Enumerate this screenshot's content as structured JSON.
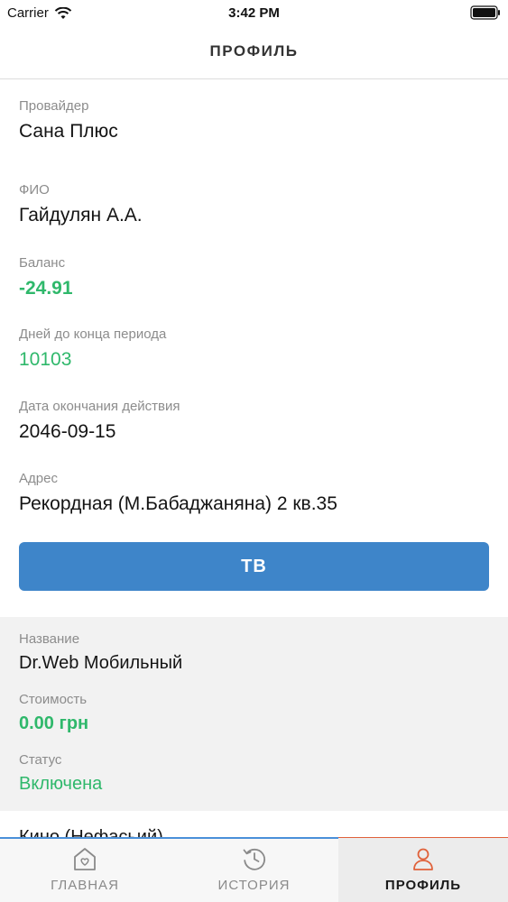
{
  "status_bar": {
    "carrier": "Carrier",
    "time": "3:42 PM",
    "icons": [
      "wifi-icon",
      "battery-icon"
    ]
  },
  "nav": {
    "title": "ПРОФИЛЬ"
  },
  "profile": {
    "provider_label": "Провайдер",
    "provider_value": "Сана Плюс",
    "name_label": "ФИО",
    "name_value": "Гайдулян А.А.",
    "balance_label": "Баланс",
    "balance_value": "-24.91",
    "days_label": "Дней до конца периода",
    "days_value": "10103",
    "end_date_label": "Дата окончания действия",
    "end_date_value": "2046-09-15",
    "address_label": "Адрес",
    "address_value": "Рекордная (М.Бабаджаняна) 2 кв.35"
  },
  "tv_button": {
    "label": "ТВ"
  },
  "service": {
    "name_label": "Название",
    "name_value": "Dr.Web Мобильный",
    "cost_label": "Стоимость",
    "cost_value": "0.00 грн",
    "status_label": "Статус",
    "status_value": "Включена"
  },
  "next_peek": {
    "text": "Кино (Нефасьий)"
  },
  "tab_bar": {
    "tabs": [
      {
        "label": "ГЛАВНАЯ",
        "icon": "home-heart-icon",
        "active": false
      },
      {
        "label": "ИСТОРИЯ",
        "icon": "history-clock-icon",
        "active": false
      },
      {
        "label": "ПРОФИЛЬ",
        "icon": "profile-person-icon",
        "active": true
      }
    ]
  },
  "colors": {
    "accent_blue": "#3e85c9",
    "positive_green": "#2fb86b",
    "active_tab_orange": "#e0613a",
    "tab_line_blue": "#4a90d9"
  }
}
